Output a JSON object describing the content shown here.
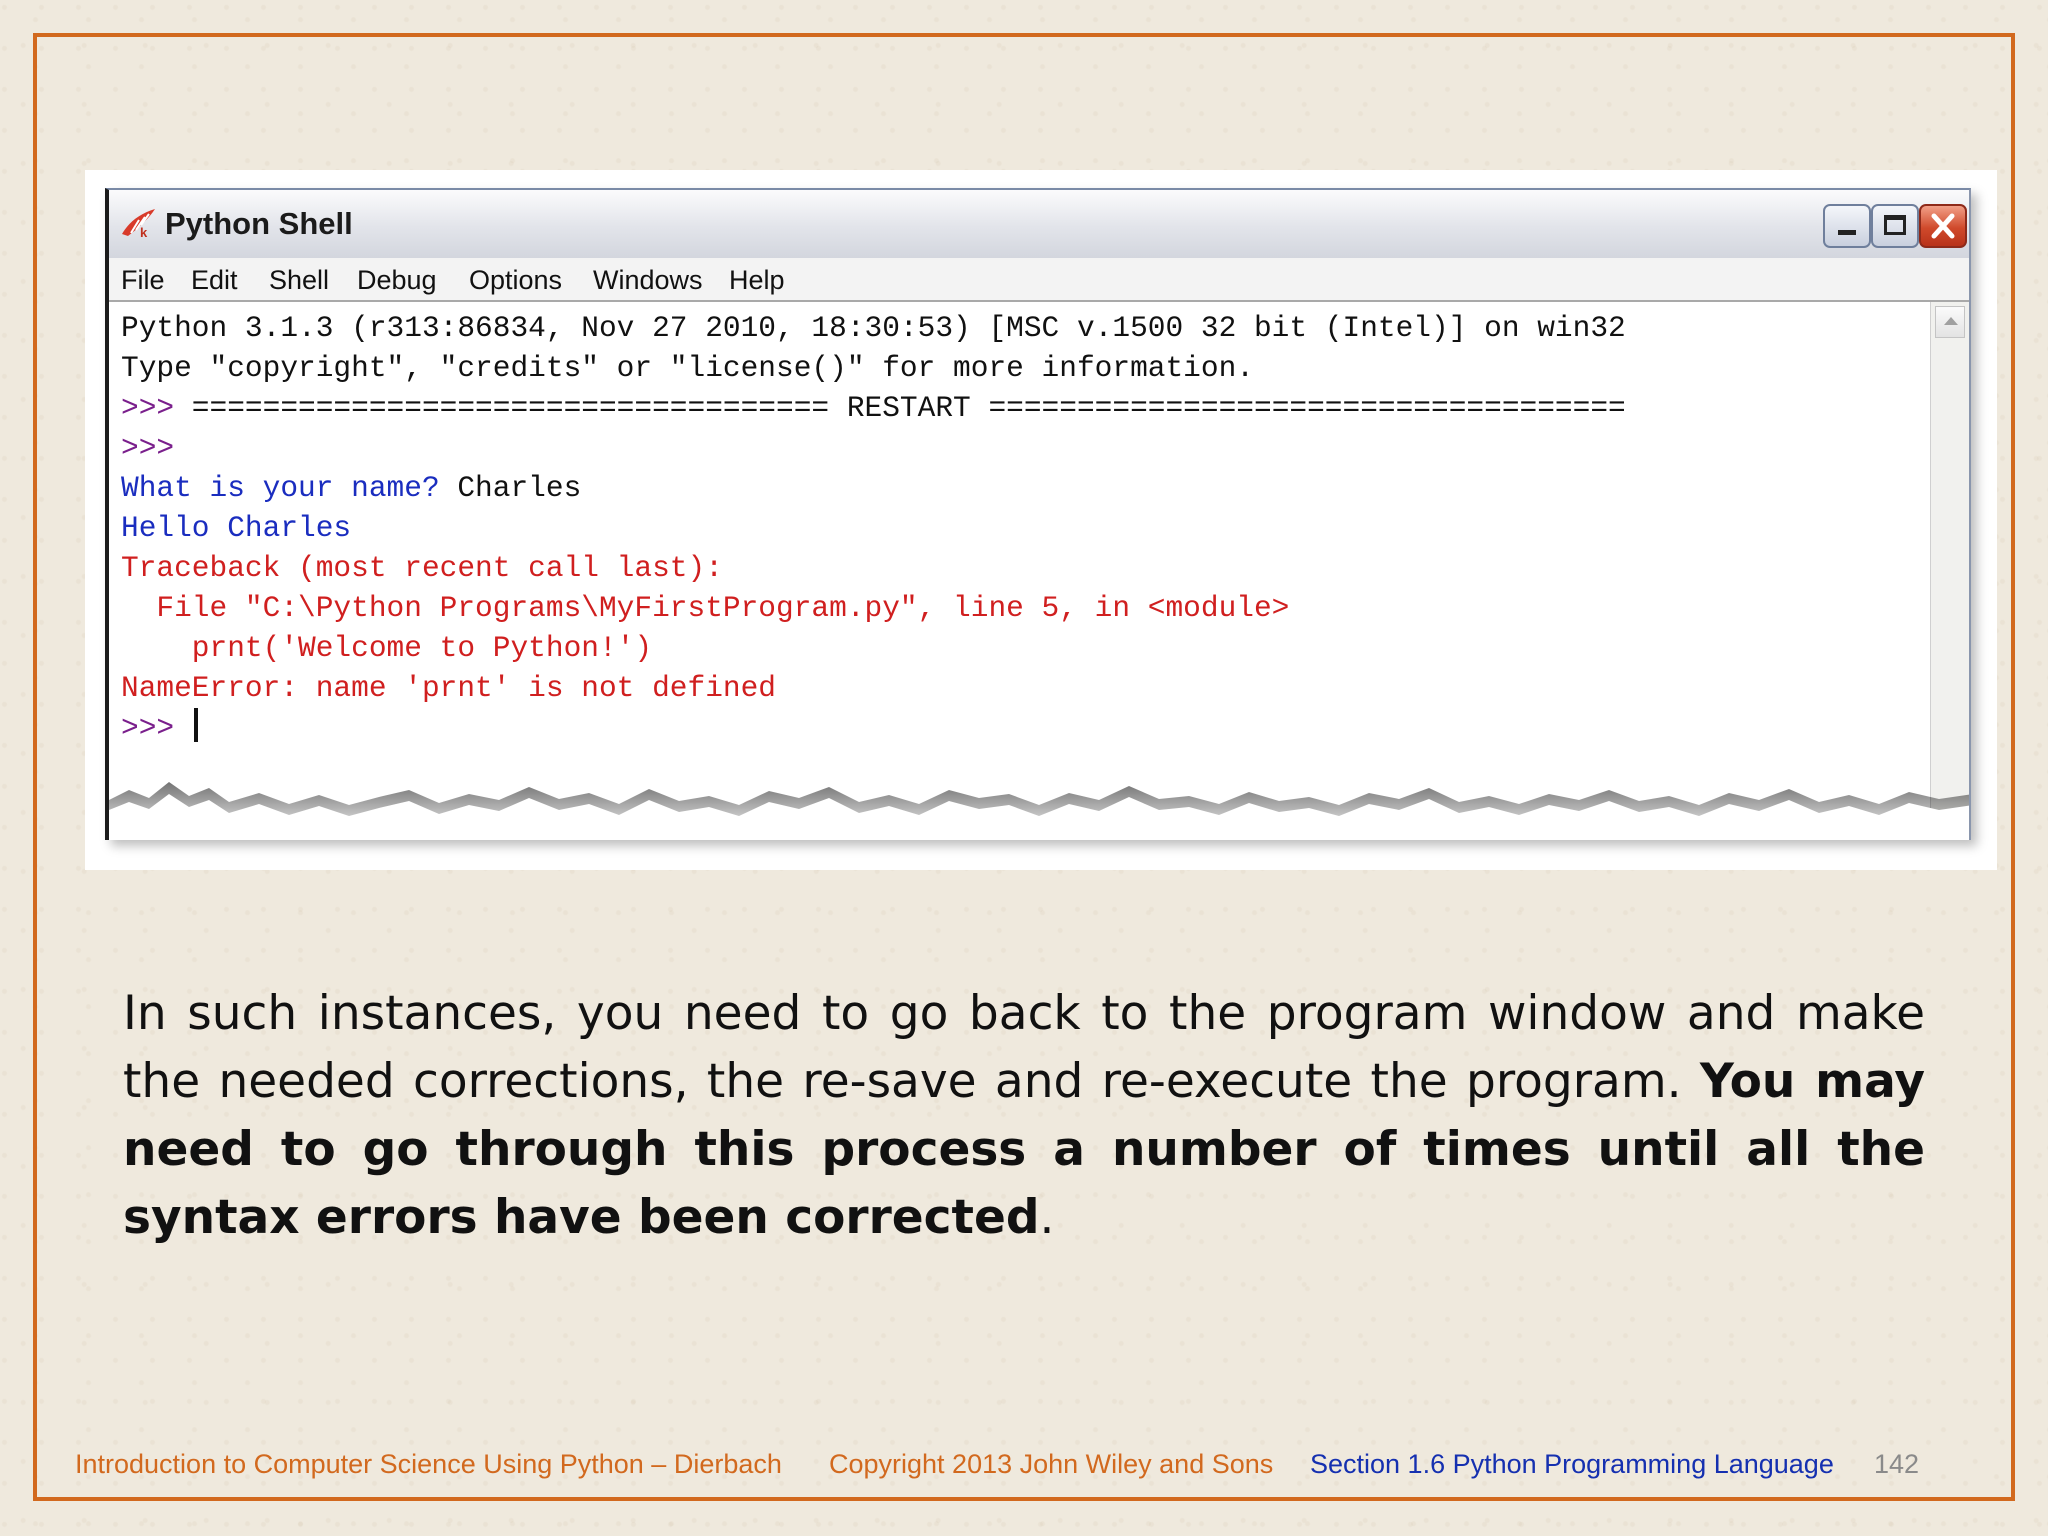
{
  "window": {
    "title": "Python Shell",
    "icon": "python-feather-icon",
    "controls": {
      "minimize": "minimize-icon",
      "maximize": "maximize-icon",
      "close": "close-icon"
    }
  },
  "menubar": [
    "File",
    "Edit",
    "Shell",
    "Debug",
    "Options",
    "Windows",
    "Help"
  ],
  "shell": {
    "banner_1": "Python 3.1.3 (r313:86834, Nov 27 2010, 18:30:53) [MSC v.1500 32 bit (Intel)] on win32",
    "banner_2": "Type \"copyright\", \"credits\" or \"license()\" for more information.",
    "prompt": ">>>",
    "restart_line": " ==================================== RESTART ====================================",
    "input_prompt": "What is your name? ",
    "input_value": "Charles",
    "output": "Hello Charles",
    "traceback_header": "Traceback (most recent call last):",
    "traceback_file": "  File \"C:\\Python Programs\\MyFirstProgram.py\", line 5, in <module>",
    "traceback_code": "    prnt('Welcome to Python!')",
    "error": "NameError: name 'prnt' is not defined",
    "final_prompt": ">>> "
  },
  "slide": {
    "text_normal": "In such instances, you need to go back to the program window and make the needed corrections, the re-save and re-execute the program. ",
    "text_bold": "You may need to go through this process a number of times until all the syntax errors have been corrected",
    "text_end": "."
  },
  "footer": {
    "book": "Introduction to Computer Science Using Python – Dierbach",
    "copyright": "Copyright 2013 John Wiley and  Sons",
    "section": "Section 1.6  Python Programming Language",
    "page": "142"
  },
  "colors": {
    "frame": "#d2691e",
    "footer_orange": "#d2691e",
    "footer_blue": "#1530b0",
    "shell_blue": "#1a2dbf",
    "shell_red": "#d01f1f"
  }
}
